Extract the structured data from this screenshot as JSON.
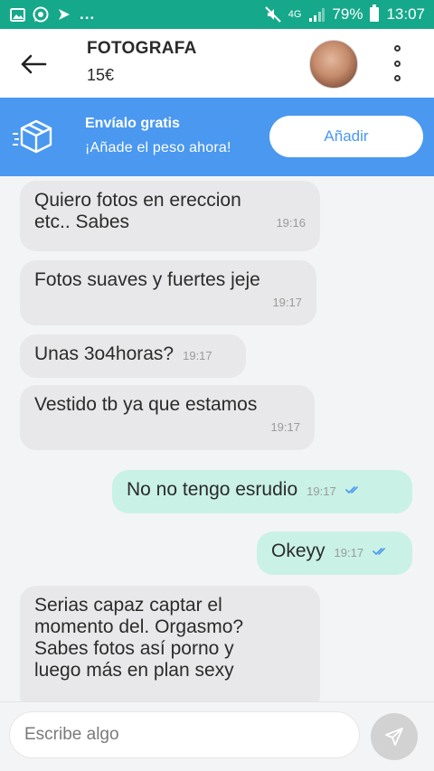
{
  "status_bar": {
    "left_icons": [
      "image-icon",
      "whatsapp-icon",
      "flag-icon"
    ],
    "dots": "...",
    "battery": "79%",
    "time": "13:07",
    "network": "4G"
  },
  "header": {
    "title": "FOTOGRAFA",
    "price": "15€"
  },
  "banner": {
    "title": "Envíalo gratis",
    "subtitle": "¡Añade el peso ahora!",
    "button": "Añadir"
  },
  "messages": [
    {
      "side": "in",
      "text": "Quiero fotos en ereccion\netc.. Sabes",
      "time": "19:16"
    },
    {
      "side": "in",
      "text": "Fotos suaves y fuertes jeje",
      "time": "19:17"
    },
    {
      "side": "in",
      "text": "Unas 3o4horas?",
      "time": "19:17"
    },
    {
      "side": "in",
      "text": "Vestido tb ya que estamos",
      "time": "19:17"
    },
    {
      "side": "out",
      "text": "No no tengo esrudio",
      "time": "19:17",
      "read": true
    },
    {
      "side": "out",
      "text": "Okeyy",
      "time": "19:17",
      "read": true
    },
    {
      "side": "in",
      "text": "Serias capaz captar el\nmomento del. Orgasmo?\nSabes fotos así porno y\nluego más en plan sexy",
      "time": ""
    }
  ],
  "composer": {
    "placeholder": "Escribe algo"
  }
}
